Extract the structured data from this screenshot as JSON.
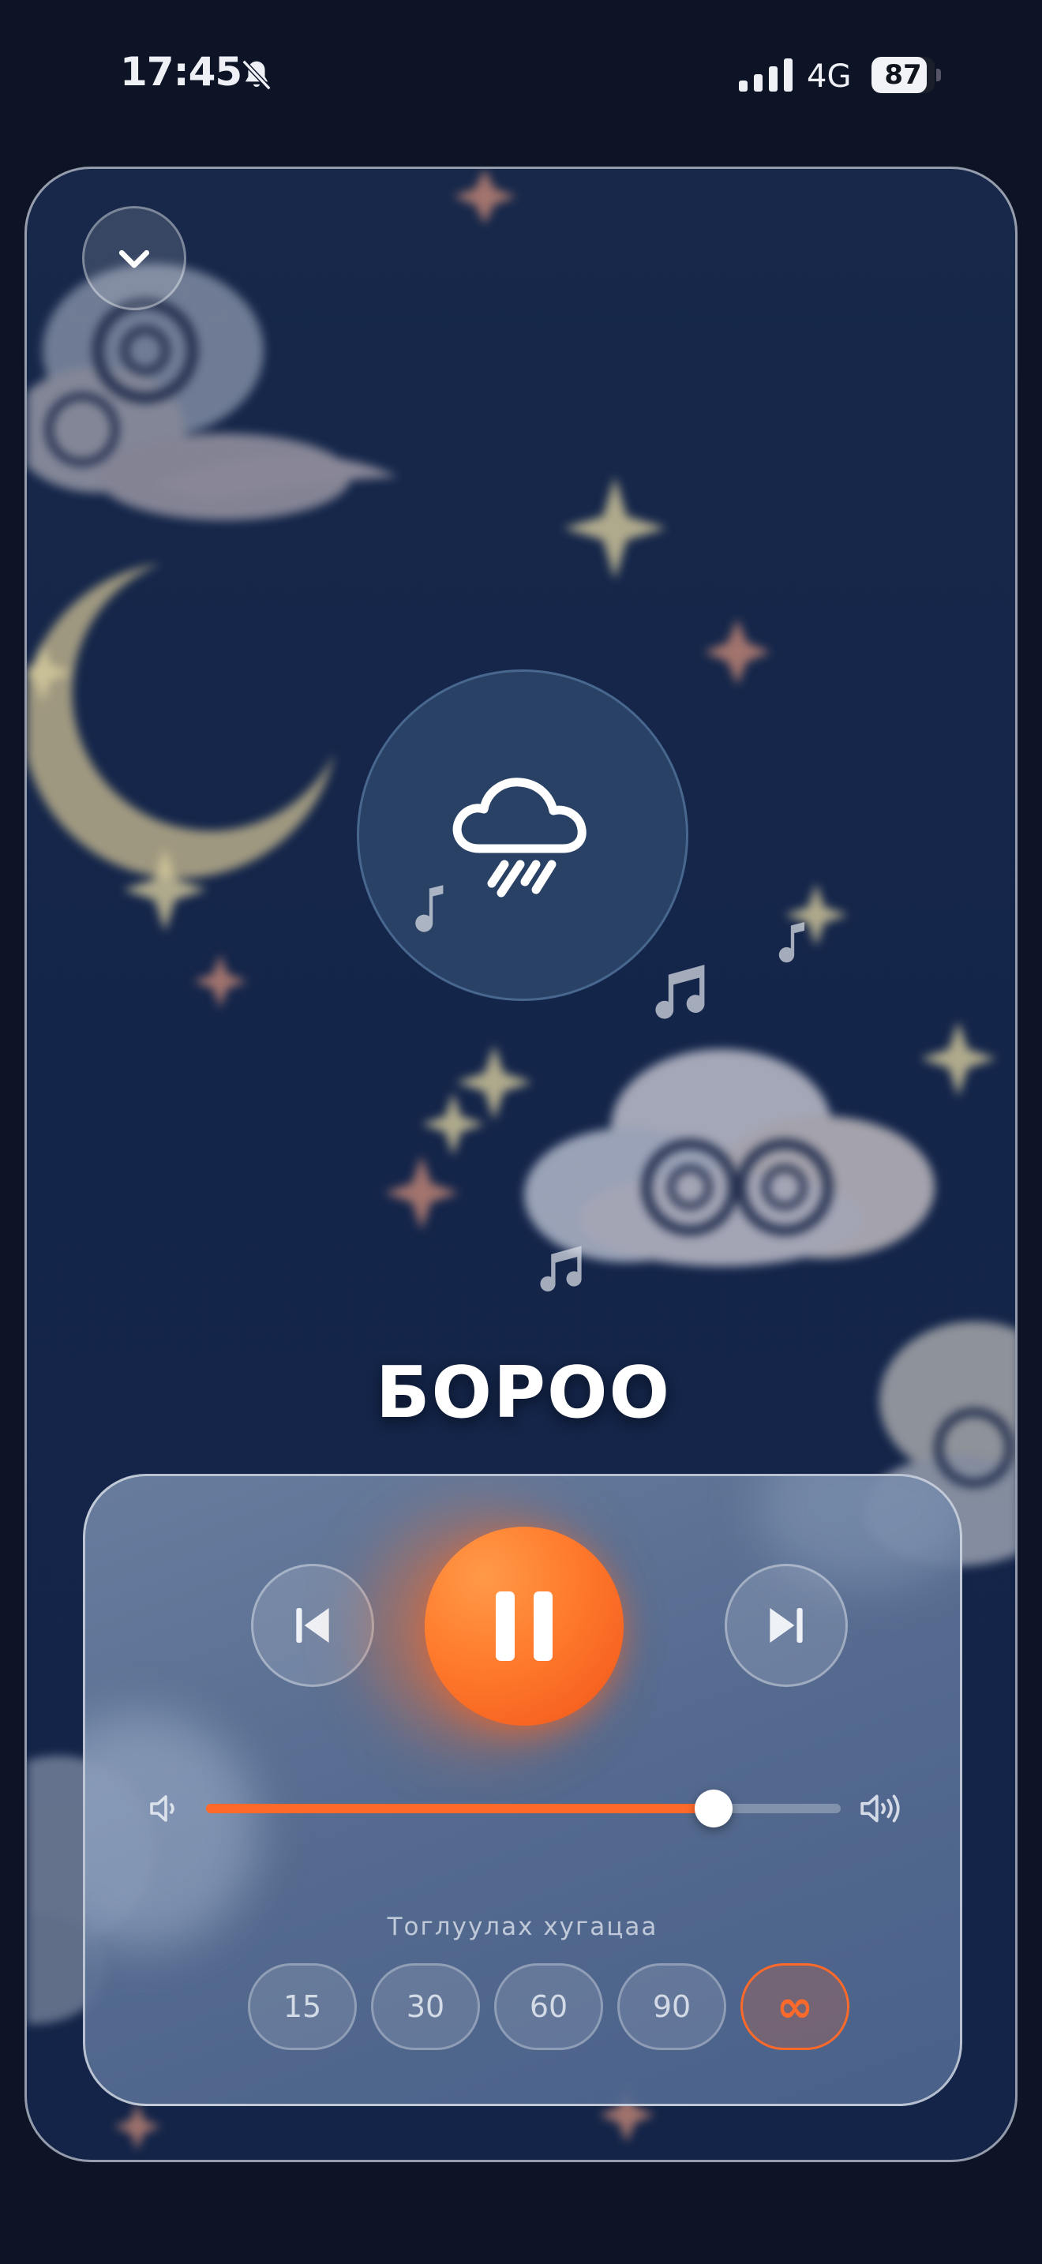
{
  "status_bar": {
    "time": "17:45",
    "network": "4G",
    "battery_percent": "87",
    "battery_level": 0.87,
    "icons": [
      "bell-slash-icon",
      "cellular-signal-icon",
      "battery-icon"
    ]
  },
  "player": {
    "close_icon": "chevron-down-icon",
    "sound_icon": "cloud-rain-icon",
    "title": "БОРОО",
    "controls": {
      "previous_icon": "skip-previous-icon",
      "pause_icon": "pause-icon",
      "next_icon": "skip-next-icon"
    },
    "volume": {
      "level": 0.8,
      "low_icon": "volume-low-icon",
      "high_icon": "volume-high-icon"
    },
    "timer": {
      "label": "Тоглуулах хугацаа",
      "options": [
        "15",
        "30",
        "60",
        "90",
        "∞"
      ],
      "selected": "∞"
    }
  },
  "colors": {
    "background": "#0c1426",
    "accent": "#ff6a2a",
    "card": "#14254a",
    "panel": "#5c7296"
  }
}
